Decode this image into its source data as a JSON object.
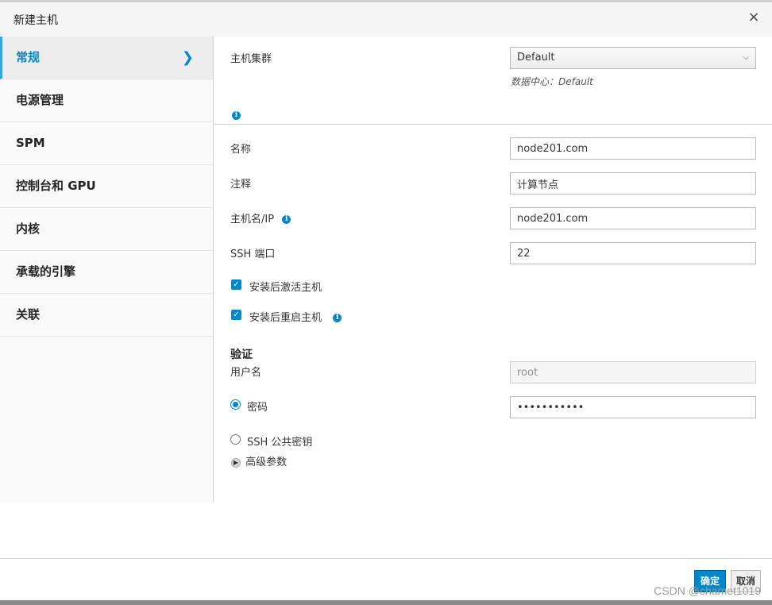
{
  "dialog": {
    "title": "新建主机",
    "close_glyph": "×"
  },
  "sidebar": {
    "items": [
      {
        "label": "常规",
        "active": true
      },
      {
        "label": "电源管理"
      },
      {
        "label": "SPM"
      },
      {
        "label": "控制台和 GPU"
      },
      {
        "label": "内核"
      },
      {
        "label": "承载的引擎"
      },
      {
        "label": "关联"
      }
    ]
  },
  "form": {
    "cluster": {
      "label": "主机集群",
      "value": "Default",
      "datacenter_text": "数据中心：Default"
    },
    "name": {
      "label": "名称",
      "value": "node201.com"
    },
    "comment": {
      "label": "注释",
      "value": "计算节点"
    },
    "hostname": {
      "label": "主机名/IP",
      "value": "node201.com"
    },
    "ssh_port": {
      "label": "SSH 端口",
      "value": "22"
    },
    "activate_after_install": {
      "label": "安装后激活主机",
      "checked": true
    },
    "reboot_after_install": {
      "label": "安装后重启主机",
      "checked": true
    },
    "auth": {
      "title": "验证",
      "username_label": "用户名",
      "username_value": "root",
      "password_label": "密码",
      "password_value": "•••••••••••",
      "ssh_key_label": "SSH 公共密钥",
      "selected": "password"
    },
    "advanced_label": "高级参数"
  },
  "footer": {
    "ok_label": "确定",
    "cancel_label": "取消"
  },
  "watermark": "CSDN @chamet1019",
  "colors": {
    "accent": "#0088ce",
    "sidebar_bg": "#fafafa",
    "header_bg": "#f5f5f5"
  }
}
